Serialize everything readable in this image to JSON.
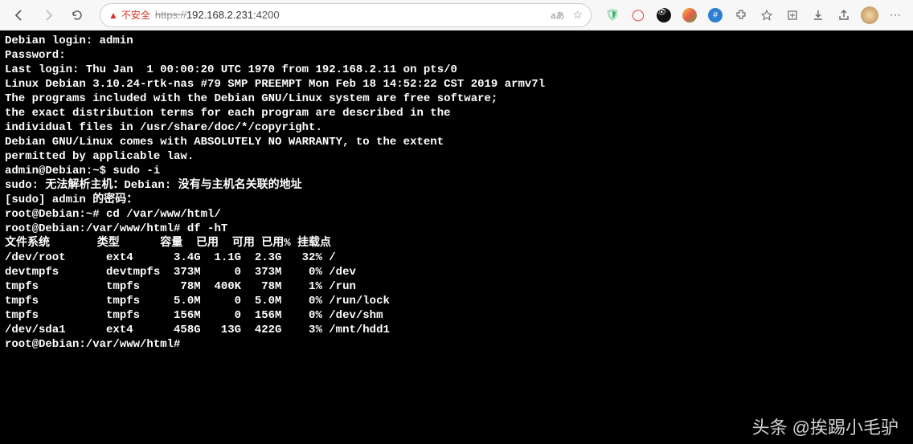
{
  "toolbar": {
    "security_label": "不安全",
    "url_prefix": "https://",
    "url_host": "192.168.2.231",
    "url_port": ":4200",
    "lang_badge": "aあ"
  },
  "terminal": {
    "lines": [
      "Debian login: admin",
      "Password:",
      "Last login: Thu Jan  1 00:00:20 UTC 1970 from 192.168.2.11 on pts/0",
      "Linux Debian 3.10.24-rtk-nas #79 SMP PREEMPT Mon Feb 18 14:52:22 CST 2019 armv7l",
      "",
      "The programs included with the Debian GNU/Linux system are free software;",
      "the exact distribution terms for each program are described in the",
      "individual files in /usr/share/doc/*/copyright.",
      "",
      "Debian GNU/Linux comes with ABSOLUTELY NO WARRANTY, to the extent",
      "permitted by applicable law.",
      "admin@Debian:~$ sudo -i",
      "sudo: 无法解析主机：Debian: 没有与主机名关联的地址",
      "[sudo] admin 的密码：",
      "root@Debian:~# cd /var/www/html/",
      "root@Debian:/var/www/html# df -hT",
      "文件系统       类型      容量  已用  可用 已用% 挂载点",
      "/dev/root      ext4      3.4G  1.1G  2.3G   32% /",
      "devtmpfs       devtmpfs  373M     0  373M    0% /dev",
      "tmpfs          tmpfs      78M  400K   78M    1% /run",
      "tmpfs          tmpfs     5.0M     0  5.0M    0% /run/lock",
      "tmpfs          tmpfs     156M     0  156M    0% /dev/shm",
      "/dev/sda1      ext4      458G   13G  422G    3% /mnt/hdd1",
      "root@Debian:/var/www/html#"
    ]
  },
  "watermark": {
    "icon": "头条",
    "text": "@挨踢小毛驴"
  }
}
